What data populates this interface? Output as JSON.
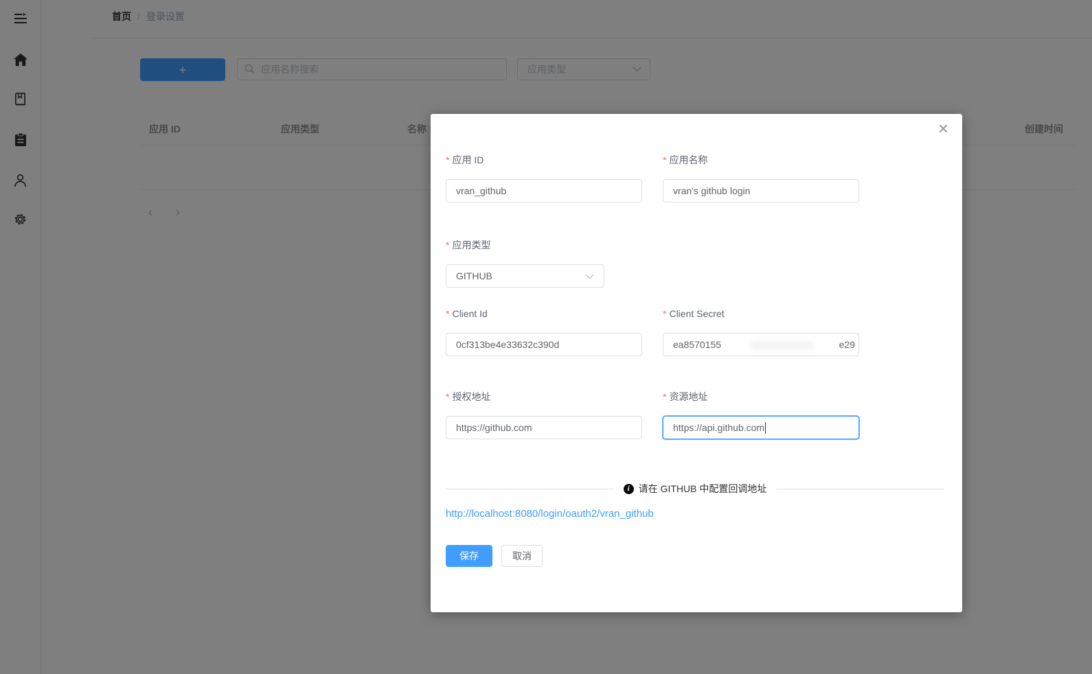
{
  "breadcrumb": {
    "home": "首页",
    "separator": "/",
    "current": "登录设置"
  },
  "sidebar": {
    "icons": [
      "menu-fold",
      "home",
      "book",
      "clipboard",
      "user",
      "gear"
    ]
  },
  "toolbar": {
    "add_label": "+",
    "search_placeholder": "应用名称搜索",
    "type_placeholder": "应用类型"
  },
  "table": {
    "columns": [
      "应用 ID",
      "应用类型",
      "名称",
      "创建时间"
    ]
  },
  "pagination": {
    "prev": "‹",
    "next": "›"
  },
  "dialog": {
    "close_glyph": "×",
    "required_mark": "*",
    "fields": {
      "app_id": {
        "label": "应用 ID",
        "value": "vran_github"
      },
      "app_name": {
        "label": "应用名称",
        "value": "vran's github login"
      },
      "app_type": {
        "label": "应用类型",
        "value": "GITHUB"
      },
      "client_id": {
        "label": "Client Id",
        "value": "0cf313be4e33632c390d"
      },
      "client_secret": {
        "label": "Client Secret",
        "value_prefix": "ea8570155",
        "value_suffix": "e29",
        "redacted": true
      },
      "auth_url": {
        "label": "授权地址",
        "value": "https://github.com"
      },
      "resource_url": {
        "label": "资源地址",
        "value": "https://api.github.com",
        "focused": true
      }
    },
    "info_icon_glyph": "i",
    "info_note": "请在 GITHUB 中配置回调地址",
    "callback_url": "http://localhost:8080/login/oauth2/vran_github",
    "save_label": "保存",
    "cancel_label": "取消"
  },
  "colors": {
    "primary": "#409EFF",
    "link": "#409EFF",
    "required_mark": "#F56C6C",
    "overlay": "rgba(0,0,0,0.5)"
  }
}
